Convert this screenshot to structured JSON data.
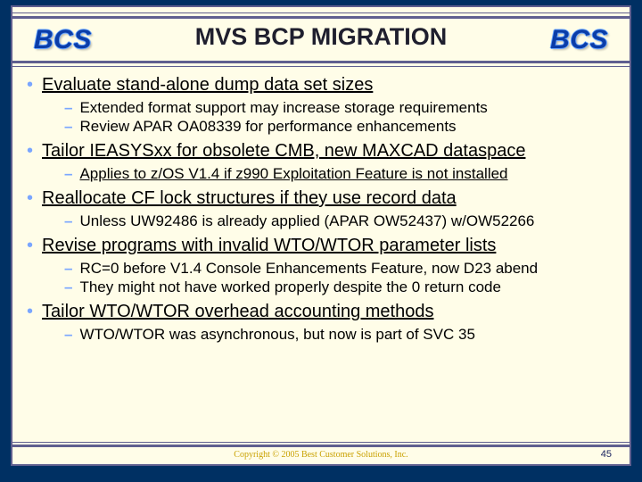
{
  "brand": "BCS",
  "title": "MVS BCP MIGRATION",
  "items": [
    {
      "text": "Evaluate stand-alone dump data set sizes",
      "sub": [
        {
          "text": "Extended format support may increase storage requirements"
        },
        {
          "text": "Review APAR OA08339 for performance enhancements"
        }
      ]
    },
    {
      "text": "Tailor IEASYSxx for obsolete CMB, new MAXCAD dataspace",
      "sub": [
        {
          "text": "Applies to z/OS V1.4 if z990 Exploitation Feature is not installed",
          "underline": true
        }
      ]
    },
    {
      "text": "Reallocate CF lock structures if they use record data",
      "sub": [
        {
          "text": "Unless UW92486 is already applied (APAR OW52437) w/OW52266"
        }
      ]
    },
    {
      "text": "Revise programs with invalid WTO/WTOR parameter lists",
      "sub": [
        {
          "text": "RC=0 before V1.4 Console Enhancements Feature, now D23 abend"
        },
        {
          "text": "They might not have worked properly despite the 0 return code"
        }
      ]
    },
    {
      "text": "Tailor WTO/WTOR overhead accounting methods",
      "sub": [
        {
          "text": "WTO/WTOR was asynchronous, but now is part of SVC 35"
        }
      ]
    }
  ],
  "copyright": "Copyright © 2005 Best Customer Solutions, Inc.",
  "page": "45"
}
